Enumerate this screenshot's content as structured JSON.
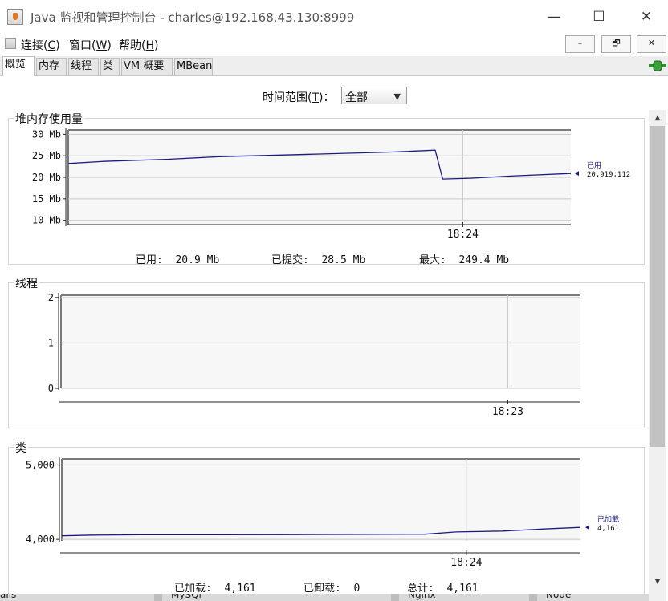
{
  "window": {
    "title": "Java 监视和管理控制台 - charles@192.168.43.130:8999",
    "controls": {
      "minimize": "—",
      "maximize": "☐",
      "close": "✕"
    }
  },
  "menu": {
    "items": [
      {
        "label": "连接(",
        "mnemonic": "C",
        "tail": ")"
      },
      {
        "label": "窗口(",
        "mnemonic": "W",
        "tail": ")"
      },
      {
        "label": "帮助(",
        "mnemonic": "H",
        "tail": ")"
      }
    ],
    "mdi_buttons": [
      "–",
      "🗗",
      "✕"
    ]
  },
  "tabs": [
    {
      "label": "概览",
      "active": true
    },
    {
      "label": "内存",
      "active": false
    },
    {
      "label": "线程",
      "active": false
    },
    {
      "label": "类",
      "active": false
    },
    {
      "label": "VM 概要",
      "active": false
    },
    {
      "label": "MBean",
      "active": false
    }
  ],
  "time_range": {
    "label": "时间范围(",
    "mnemonic": "T",
    "tail": ")：",
    "value": "全部"
  },
  "panels": {
    "heap": {
      "title": "堆内存使用量",
      "summary": {
        "used_label": "已用:",
        "used_value": "20.9  Mb",
        "committed_label": "已提交:",
        "committed_value": "28.5  Mb",
        "max_label": "最大:",
        "max_value": "249.4  Mb"
      }
    },
    "threads": {
      "title": "线程"
    },
    "classes": {
      "title": "类",
      "summary": {
        "loaded_label": "已加载:",
        "loaded_value": "4,161",
        "unloaded_label": "已卸载:",
        "unloaded_value": "0",
        "total_label": "总计:",
        "total_value": "4,161"
      }
    }
  },
  "chart_data": [
    {
      "type": "line",
      "name": "heap",
      "y_ticks": [
        10,
        15,
        20,
        25,
        30
      ],
      "y_tick_labels": [
        "10 Mb",
        "15 Mb",
        "20 Mb",
        "25 Mb",
        "30 Mb"
      ],
      "ylim": [
        9,
        31
      ],
      "x_tick_labels": [
        "18:24"
      ],
      "x_tick_positions": [
        0.785
      ],
      "series": [
        {
          "name": "已用",
          "x": [
            0,
            0.07,
            0.2,
            0.3,
            0.5,
            0.65,
            0.73,
            0.745,
            0.8,
            0.88,
            1.0
          ],
          "values": [
            23.2,
            23.7,
            24.2,
            24.8,
            25.4,
            25.9,
            26.3,
            19.6,
            19.8,
            20.3,
            20.9
          ]
        }
      ],
      "legend_label": "已用",
      "legend_value": "20,919,112"
    },
    {
      "type": "line",
      "name": "threads",
      "y_ticks": [
        0,
        1,
        2
      ],
      "y_tick_labels": [
        "0",
        "1",
        "2"
      ],
      "ylim": [
        0,
        2.05
      ],
      "x_tick_labels": [
        "18:23"
      ],
      "x_tick_positions": [
        0.86
      ],
      "series": []
    },
    {
      "type": "line",
      "name": "classes",
      "y_ticks": [
        4000,
        5000
      ],
      "y_tick_labels": [
        "4,000",
        "5,000"
      ],
      "ylim": [
        3980,
        5080
      ],
      "x_tick_labels": [
        "18:24"
      ],
      "x_tick_positions": [
        0.78
      ],
      "series": [
        {
          "name": "已加载",
          "x": [
            0,
            0.06,
            0.15,
            0.3,
            0.45,
            0.6,
            0.7,
            0.76,
            0.85,
            0.93,
            1.0
          ],
          "values": [
            4048,
            4058,
            4062,
            4062,
            4064,
            4068,
            4070,
            4100,
            4112,
            4140,
            4161
          ]
        }
      ],
      "legend_label": "已加载",
      "legend_value": "4,161"
    }
  ],
  "bottom_strip": [
    "ails",
    "MySQl",
    "Nginx",
    "Node"
  ],
  "colors": {
    "series": "#1c1c80",
    "grid": "#c9c9c9",
    "plot_bg": "#f7f7f7",
    "frame": "#7a7a7a"
  }
}
